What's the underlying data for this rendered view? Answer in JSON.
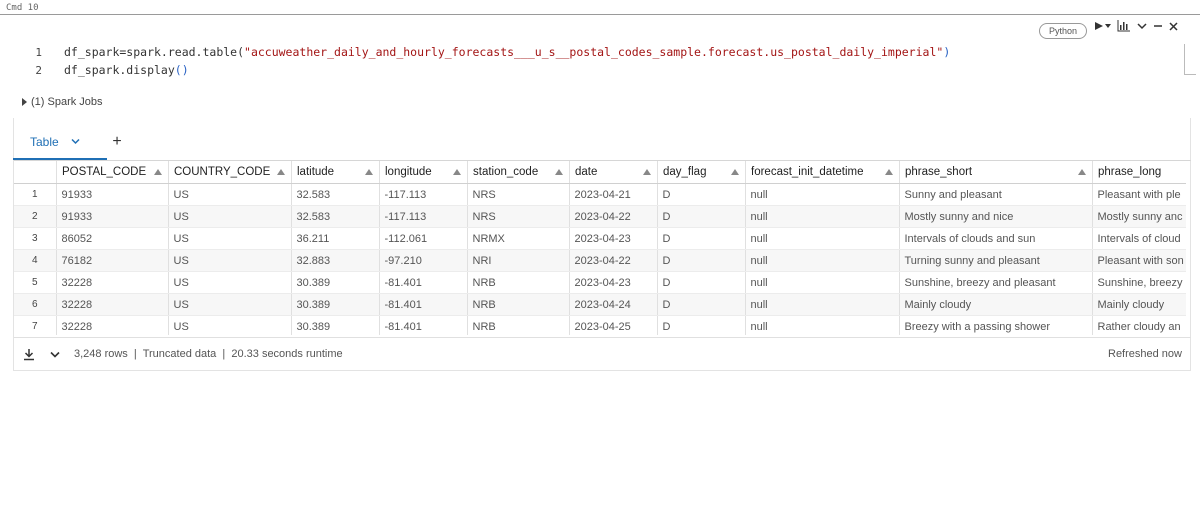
{
  "cell": {
    "label": "Cmd 10",
    "language": "Python",
    "code_lines": [
      {
        "num": "1",
        "pre": "df_spark=spark.read.table(",
        "str": "\"accuweather_daily_and_hourly_forecasts___u_s__postal_codes_sample.forecast.us_postal_daily_imperial\"",
        "post": ")"
      },
      {
        "num": "2",
        "pre": "df_spark.display",
        "str": "",
        "post": "()"
      }
    ]
  },
  "spark_jobs": "(1) Spark Jobs",
  "tabs": {
    "table_label": "Table",
    "add_label": "+"
  },
  "table": {
    "columns": [
      "POSTAL_CODE",
      "COUNTRY_CODE",
      "latitude",
      "longitude",
      "station_code",
      "date",
      "day_flag",
      "forecast_init_datetime",
      "phrase_short",
      "phrase_long"
    ],
    "rows": [
      {
        "idx": "1",
        "cells": [
          "91933",
          "US",
          "32.583",
          "-117.113",
          "NRS",
          "2023-04-21",
          "D",
          "null",
          "Sunny and pleasant",
          "Pleasant with ple"
        ]
      },
      {
        "idx": "2",
        "cells": [
          "91933",
          "US",
          "32.583",
          "-117.113",
          "NRS",
          "2023-04-22",
          "D",
          "null",
          "Mostly sunny and nice",
          "Mostly sunny anc"
        ]
      },
      {
        "idx": "3",
        "cells": [
          "86052",
          "US",
          "36.211",
          "-112.061",
          "NRMX",
          "2023-04-23",
          "D",
          "null",
          "Intervals of clouds and sun",
          "Intervals of cloud"
        ]
      },
      {
        "idx": "4",
        "cells": [
          "76182",
          "US",
          "32.883",
          "-97.210",
          "NRI",
          "2023-04-22",
          "D",
          "null",
          "Turning sunny and pleasant",
          "Pleasant with son"
        ]
      },
      {
        "idx": "5",
        "cells": [
          "32228",
          "US",
          "30.389",
          "-81.401",
          "NRB",
          "2023-04-23",
          "D",
          "null",
          "Sunshine, breezy and pleasant",
          "Sunshine, breezy"
        ]
      },
      {
        "idx": "6",
        "cells": [
          "32228",
          "US",
          "30.389",
          "-81.401",
          "NRB",
          "2023-04-24",
          "D",
          "null",
          "Mainly cloudy",
          "Mainly cloudy"
        ]
      },
      {
        "idx": "7",
        "cells": [
          "32228",
          "US",
          "30.389",
          "-81.401",
          "NRB",
          "2023-04-25",
          "D",
          "null",
          "Breezy with a passing shower",
          "Rather cloudy an"
        ]
      }
    ]
  },
  "footer": {
    "summary": "3,248 rows  |  Truncated data  |  20.33 seconds runtime",
    "refreshed": "Refreshed now"
  },
  "colors": {
    "accent": "#1f6fb5",
    "string": "#a31515",
    "paren": "#2962c4"
  }
}
